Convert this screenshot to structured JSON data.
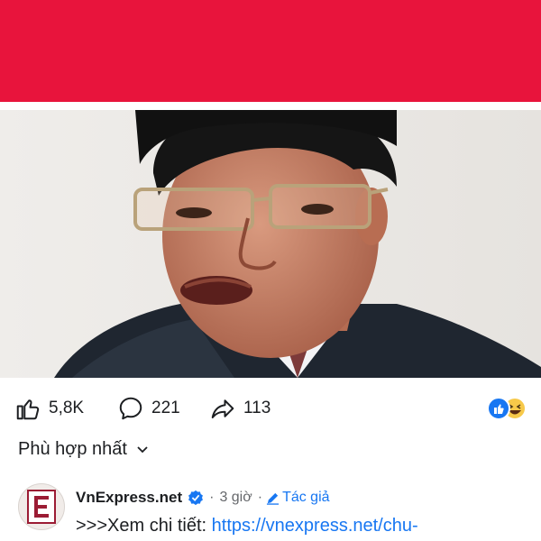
{
  "colors": {
    "banner_red": "#e8143c",
    "link_blue": "#1877f2",
    "meta_grey": "#65676b"
  },
  "post": {
    "likes_count": "5,8K",
    "comments_count": "221",
    "shares_count": "113",
    "reactions": [
      "like-reaction-icon",
      "laugh-reaction-icon"
    ]
  },
  "comments_filter": {
    "label": "Phù hợp nhất"
  },
  "comment": {
    "author": "VnExpress.net",
    "verified": true,
    "time": "3 giờ",
    "separator": "·",
    "role": "Tác giả",
    "text_prefix": ">>>Xem chi tiết: ",
    "link": "https://vnexpress.net/chu-"
  }
}
